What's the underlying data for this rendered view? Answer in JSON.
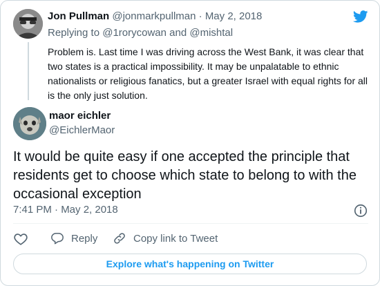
{
  "parent_tweet": {
    "author_name": "Jon Pullman",
    "author_handle": "@jonmarkpullman",
    "separator": "·",
    "date": "May 2, 2018",
    "replying_prefix": "Replying to",
    "reply_mention_1": "@1rorycowan",
    "reply_and": "and",
    "reply_mention_2": "@mishtal",
    "text": "Problem is. Last time I was driving across the West Bank, it was clear that two states is a practical impossibility. It may be unpalatable to ethnic nationalists or religious fanatics, but a greater Israel with equal rights for all is the only just solution."
  },
  "main_tweet": {
    "author_name": "maor eichler",
    "author_handle": "@EichlerMaor",
    "text": "It would be quite easy if one accepted the principle that residents get to choose which state to belong to with the occasional exception",
    "timestamp": "7:41 PM · May 2, 2018"
  },
  "actions": {
    "reply_label": "Reply",
    "copy_link_label": "Copy link to Tweet"
  },
  "explore_label": "Explore what's happening on Twitter",
  "icons": {
    "brand": "twitter-bird-icon",
    "info": "info-icon",
    "like": "heart-icon",
    "reply": "speech-bubble-icon",
    "copy": "link-icon"
  },
  "colors": {
    "brand": "#1d9bf0",
    "text": "#0f1419",
    "muted": "#536471",
    "border": "#cfd9de"
  }
}
